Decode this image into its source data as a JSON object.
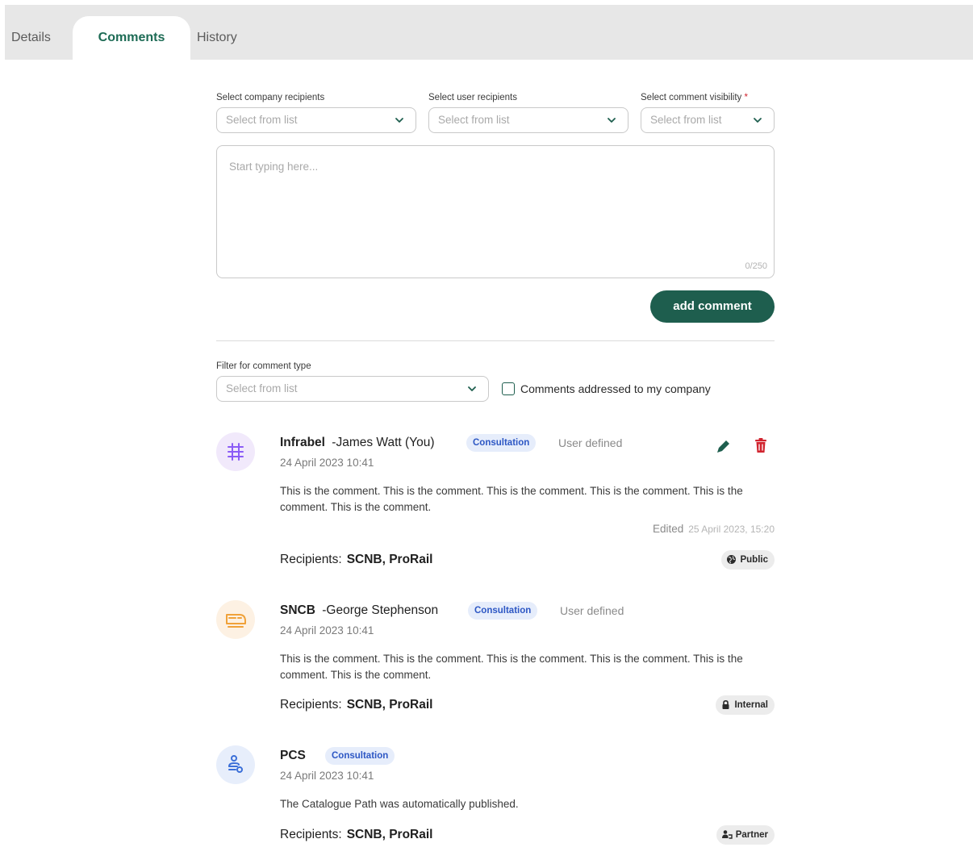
{
  "tabs": {
    "details": "Details",
    "comments": "Comments",
    "history": "History"
  },
  "form": {
    "company_label": "Select company recipients",
    "company_placeholder": "Select from list",
    "user_label": "Select user recipients",
    "user_placeholder": "Select from list",
    "visibility_label": "Select comment visibility",
    "visibility_required": "*",
    "visibility_placeholder": "Select from list",
    "comment_placeholder": "Start typing here...",
    "char_count": "0/250",
    "add_button": "add comment"
  },
  "filter": {
    "label": "Filter for comment type",
    "placeholder": "Select from list",
    "checkbox_label": "Comments addressed to my company",
    "checkbox_checked": false
  },
  "comments": [
    {
      "company": "Infrabel",
      "user": "-James Watt (You)",
      "type": "Consultation",
      "source": "User defined",
      "date": "24 April 2023 10:41",
      "text": "This is the comment. This is the comment. This is the comment. This is the comment. This is the comment. This is the comment.",
      "edited_label": "Edited",
      "edited_at": "25 April 2023, 15:20",
      "recipients_label": "Recipients:",
      "recipients": "SCNB, ProRail",
      "visibility": "Public",
      "avatar_color": "#f1e9fb",
      "avatar_icon_color": "#8b5cf6"
    },
    {
      "company": "SNCB",
      "user": "-George Stephenson",
      "type": "Consultation",
      "source": "User defined",
      "date": "24 April 2023 10:41",
      "text": "This is the comment. This is the comment. This is the comment. This is the comment. This is the comment. This is the comment.",
      "recipients_label": "Recipients:",
      "recipients": "SCNB, ProRail",
      "visibility": "Internal",
      "avatar_color": "#fdf1e3",
      "avatar_icon_color": "#f0a23a"
    },
    {
      "company": "PCS",
      "type": "Consultation",
      "date": "24 April 2023 10:41",
      "text": "The Catalogue Path was automatically published.",
      "recipients_label": "Recipients:",
      "recipients": "SCNB, ProRail",
      "visibility": "Partner",
      "avatar_color": "#e7eefb",
      "avatar_icon_color": "#3b6fd8"
    }
  ],
  "colors": {
    "accent": "#1e5e4e",
    "badge_bg": "#e6edfb",
    "badge_text": "#2d57c4",
    "delete": "#d1242f"
  },
  "icons": {
    "edit": "pencil-icon",
    "delete": "trash-icon",
    "public": "globe-icon",
    "internal": "lock-icon",
    "partner": "handshake-icon"
  }
}
